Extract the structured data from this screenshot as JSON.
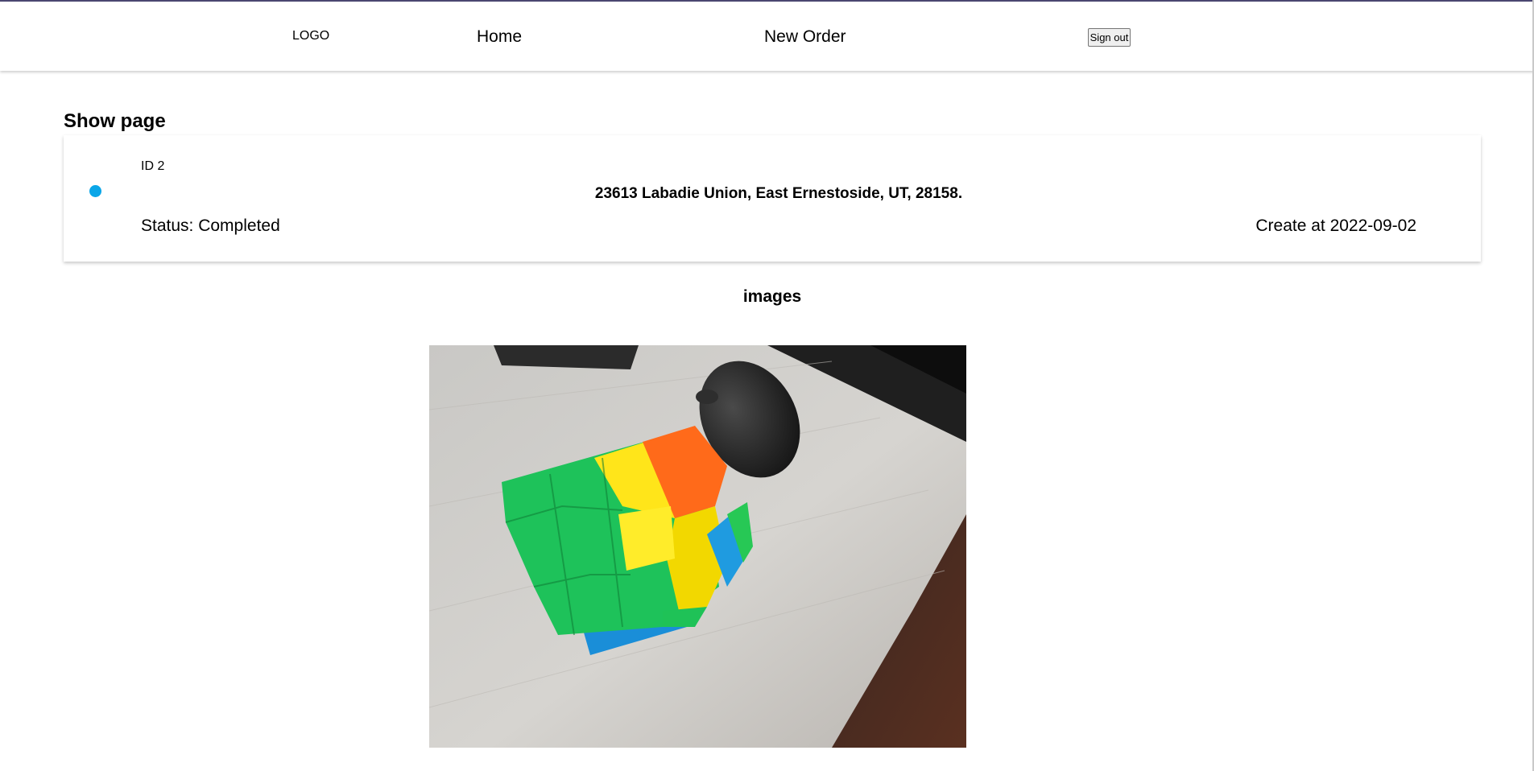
{
  "nav": {
    "logo": "LOGO",
    "home_label": "Home",
    "new_order_label": "New Order",
    "sign_out_label": "Sign out"
  },
  "page": {
    "title": "Show page"
  },
  "order": {
    "id_text": "ID 2",
    "address": "23613 Labadie Union, East Ernestoside, UT, 28158.",
    "status_text": "Status: Completed",
    "created_text": "Create at 2022-09-02",
    "status_color": "#0aa6e8"
  },
  "images": {
    "heading": "images",
    "items": [
      {
        "icon": "photo-rubiks-cube-and-mouse"
      }
    ]
  }
}
